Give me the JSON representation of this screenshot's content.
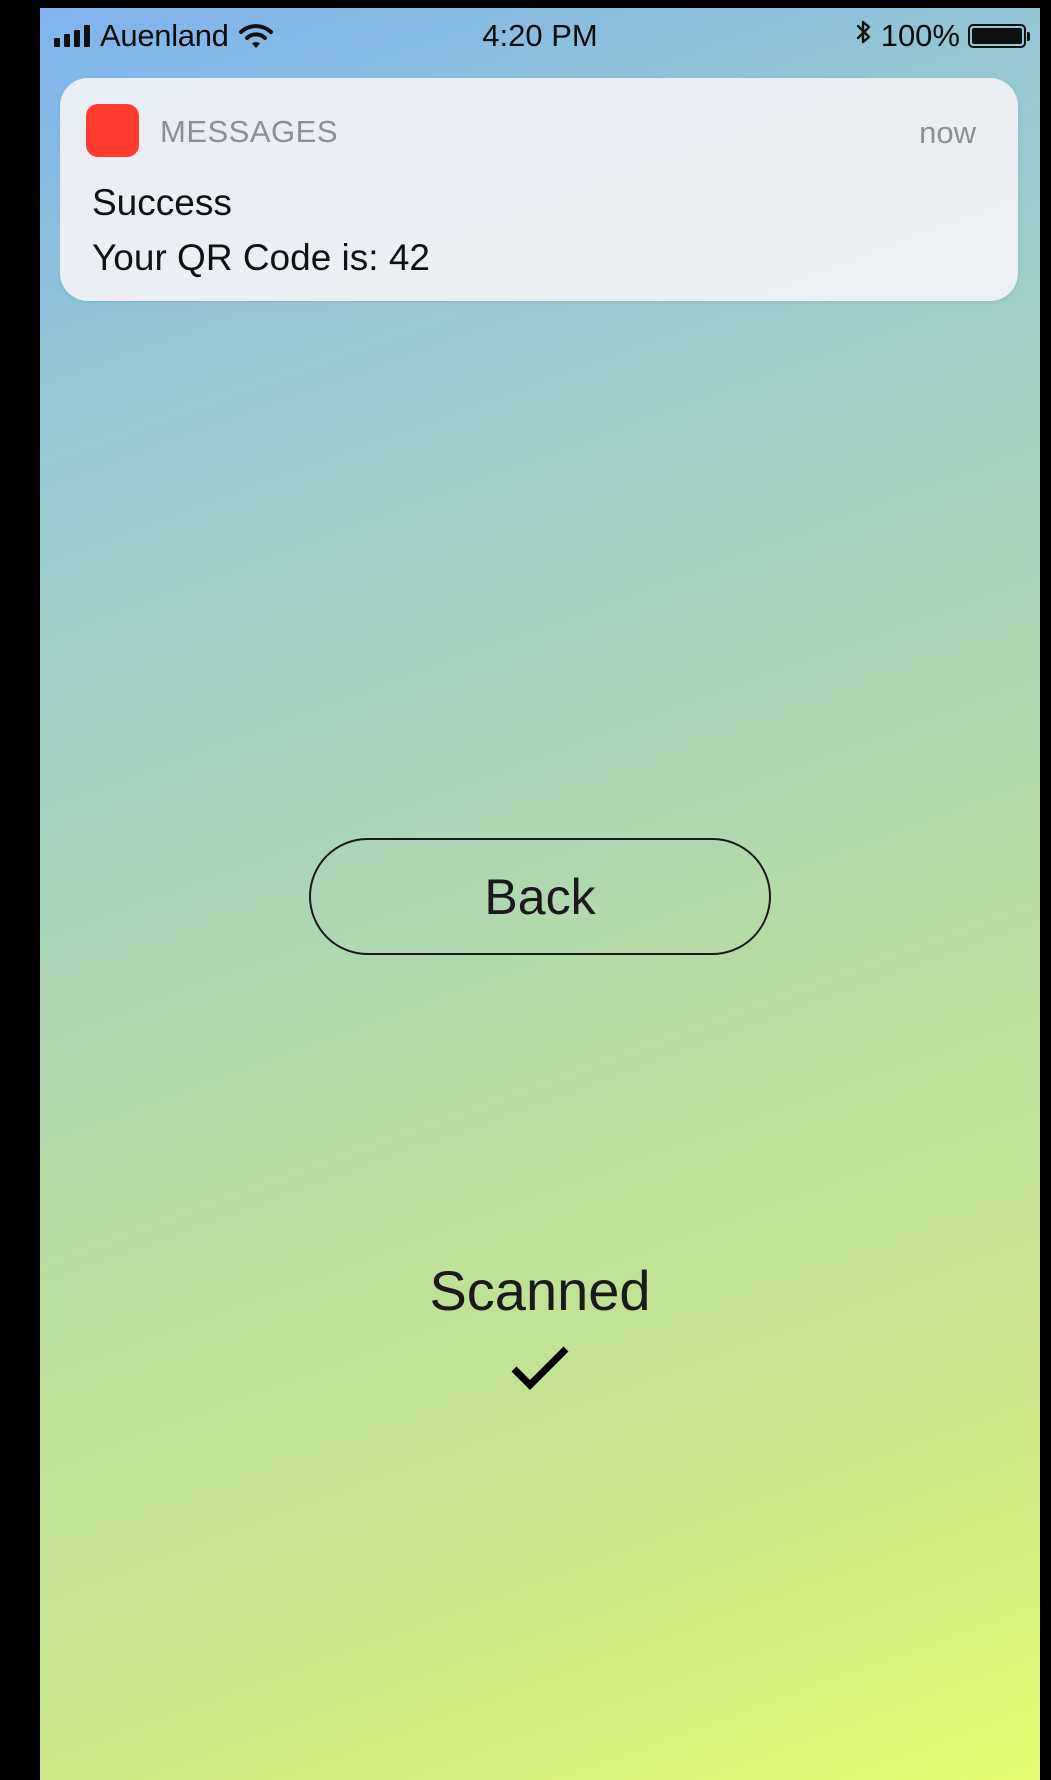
{
  "status_bar": {
    "carrier": "Auenland",
    "time": "4:20 PM",
    "battery_percent": "100%",
    "battery_level": 1.0,
    "icons": [
      "signal-bars-icon",
      "wifi-icon",
      "bluetooth-icon",
      "battery-icon"
    ]
  },
  "notification": {
    "app_name": "MESSAGES",
    "time": "now",
    "title": "Success",
    "body": "Your QR Code is: 42",
    "app_icon_color": "#ff3b30"
  },
  "main": {
    "back_label": "Back",
    "status_label": "Scanned",
    "status_icon": "checkmark-icon"
  },
  "colors": {
    "gradient_top": "#7fb3ef",
    "gradient_bottom": "#e2fb6f",
    "text": "#1a1a1a"
  }
}
